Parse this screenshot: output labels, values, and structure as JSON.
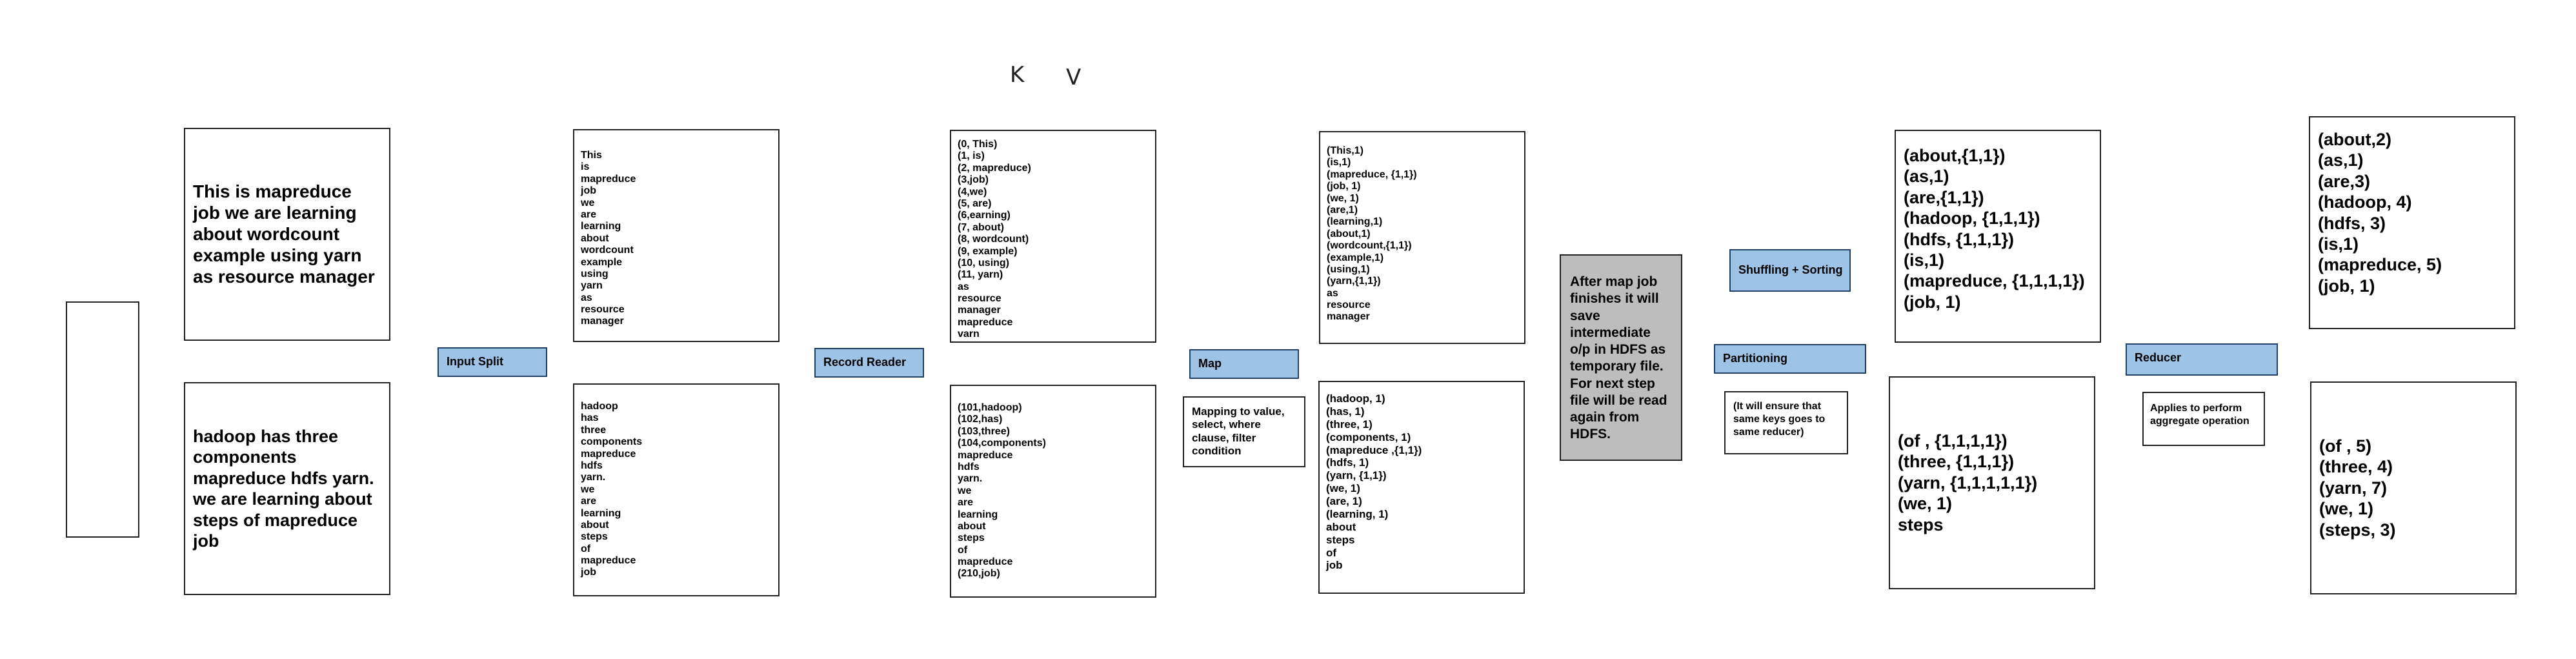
{
  "annotations": {
    "k": "K",
    "v": "V"
  },
  "input_split": {
    "label": "Input Split",
    "doc1": "This is mapreduce\njob we are learning\nabout wordcount\nexample using yarn\nas resource manager",
    "doc2": "hadoop has three\ncomponents\nmapreduce hdfs yarn.\nwe are learning about\nsteps of mapreduce\njob",
    "split1": "This\nis\nmapreduce\njob\nwe\nare\n learning\nabout\nwordcount\nexample\nusing\nyarn\nas\nresource\nmanager",
    "split2": "hadoop\nhas\nthree\ncomponents\nmapreduce\nhdfs\nyarn.\nwe\nare\nlearning\nabout\nsteps\nof\nmapreduce\njob"
  },
  "record_reader": {
    "label": "Record Reader",
    "out1": "(0, This)\n(1, is)\n(2, mapreduce)\n(3,job)\n(4,we)\n(5, are)\n (6,earning)\n(7, about)\n(8, wordcount)\n(9, example)\n(10, using)\n(11, yarn)\nas\nresource\nmanager\nmapreduce\nvarn",
    "out2": "(101,hadoop)\n(102,has)\n(103,three)\n(104,components)\nmapreduce\nhdfs\nyarn.\nwe\nare\nlearning\nabout\nsteps\nof\nmapreduce\n(210,job)"
  },
  "map": {
    "label": "Map",
    "note": "Mapping to value,\nselect, where\nclause, filter\ncondition",
    "out1": "(This,1)\n(is,1)\n(mapreduce, {1,1})\n(job, 1)\n (we, 1)\n(are,1)\n (learning,1)\n(about,1)\n(wordcount,{1,1})\n(example,1)\n(using,1)\n(yarn,{1,1})\nas\nresource\nmanager",
    "out2": "(hadoop, 1)\n(has, 1)\n(three, 1)\n(components, 1)\n(mapreduce ,{1,1})\n(hdfs, 1)\n(yarn, {1,1})\n(we, 1)\n(are, 1)\n(learning, 1)\nabout\nsteps\nof\njob"
  },
  "intermediate_note": "After map job\nfinishes it will\nsave\nintermediate\no/p in HDFS as\ntemporary file.\nFor next step\nfile will be read\nagain from\nHDFS.",
  "shuffle": {
    "label": "Shuffling + Sorting",
    "out1": "(about,{1,1})\n(as,1)\n(are,{1,1})\n(hadoop, {1,1,1})\n(hdfs, {1,1,1})\n(is,1)\n(mapreduce, {1,1,1,1})\n(job, 1)",
    "out2": "(of , {1,1,1,1})\n(three, {1,1,1})\n(yarn, {1,1,1,1,1})\n(we, 1)\nsteps"
  },
  "partitioning": {
    "label": "Partitioning",
    "note": "(It will ensure that\nsame keys goes to\nsame reducer)"
  },
  "reducer": {
    "label": "Reducer",
    "note": "Applies to perform\naggregate operation",
    "out1": "(about,2)\n(as,1)\n(are,3)\n(hadoop, 4)\n(hdfs, 3)\n(is,1)\n(mapreduce, 5)\n(job, 1)",
    "out2": "(of , 5)\n(three, 4)\n(yarn, 7)\n(we, 1)\n(steps, 3)"
  }
}
